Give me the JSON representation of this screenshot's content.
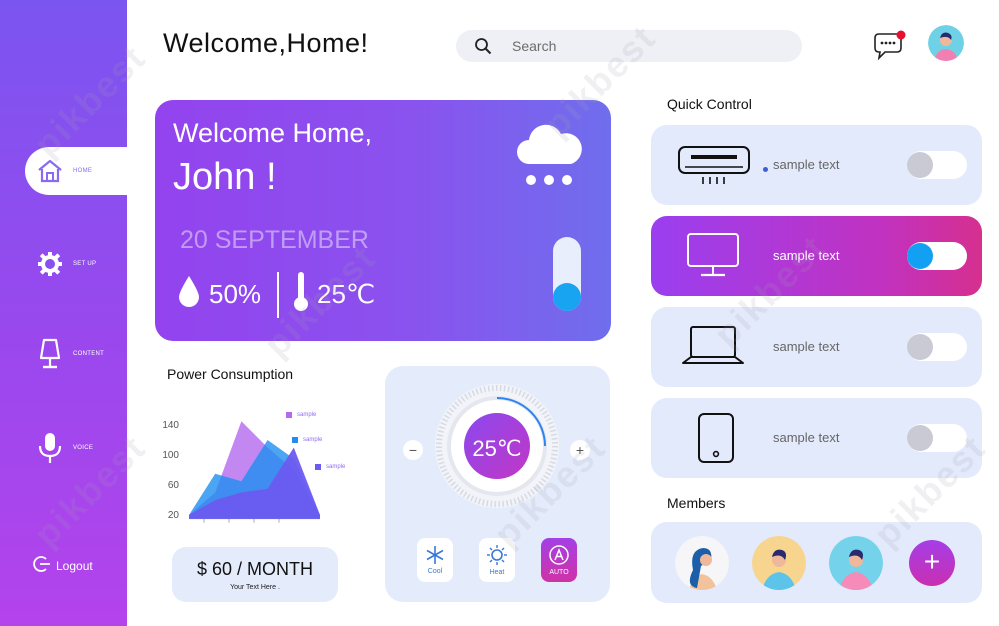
{
  "sidebar": {
    "items": [
      {
        "label": "HOME",
        "icon": "home-icon"
      },
      {
        "label": "SET UP",
        "icon": "gear-icon"
      },
      {
        "label": "CONTENT",
        "icon": "lamp-icon"
      },
      {
        "label": "VOICE",
        "icon": "microphone-icon"
      }
    ],
    "logout_label": "Logout"
  },
  "header": {
    "title": "Welcome,Home!",
    "search_placeholder": "Search",
    "has_notification": true
  },
  "hero": {
    "greeting": "Welcome Home,",
    "name": "John !",
    "date": "20 SEPTEMBER",
    "humidity": "50%",
    "temperature": "25℃",
    "weather_icon": "cloud-snow-icon",
    "slider_level": 0.35
  },
  "power": {
    "title": "Power Consumption",
    "price": "$ 60 / MONTH",
    "price_sub": "Your Text Here ."
  },
  "chart_data": {
    "type": "area",
    "x": [
      0,
      1,
      2,
      3,
      4,
      5
    ],
    "yticks": [
      20,
      60,
      100,
      140
    ],
    "ylim": [
      0,
      160
    ],
    "series": [
      {
        "name": "sample",
        "color": "#b469ef",
        "values": [
          20,
          50,
          145,
          110,
          80,
          20
        ]
      },
      {
        "name": "sample",
        "color": "#1e8fef",
        "values": [
          20,
          75,
          65,
          120,
          95,
          20
        ]
      },
      {
        "name": "sample",
        "color": "#6b5bf0",
        "values": [
          20,
          40,
          50,
          55,
          110,
          20
        ]
      }
    ]
  },
  "thermostat": {
    "temperature": "25℃",
    "minus": "−",
    "plus": "+",
    "modes": [
      {
        "label": "Cool",
        "icon": "snowflake-icon"
      },
      {
        "label": "Heat",
        "icon": "sun-icon"
      },
      {
        "label": "AUTO",
        "icon": "auto-icon"
      }
    ]
  },
  "quick_control": {
    "title": "Quick Control",
    "devices": [
      {
        "label": "sample text",
        "icon": "air-conditioner-icon",
        "on": false
      },
      {
        "label": "sample text",
        "icon": "monitor-icon",
        "on": true
      },
      {
        "label": "sample text",
        "icon": "laptop-icon",
        "on": false
      },
      {
        "label": "sample text",
        "icon": "tablet-icon",
        "on": false
      }
    ]
  },
  "members": {
    "title": "Members",
    "add_label": "+"
  },
  "watermark": "pikbest",
  "colors": {
    "accent": "#8b4ff0",
    "toggle_on": "#139ff2",
    "card_bg": "#e3eafc"
  }
}
